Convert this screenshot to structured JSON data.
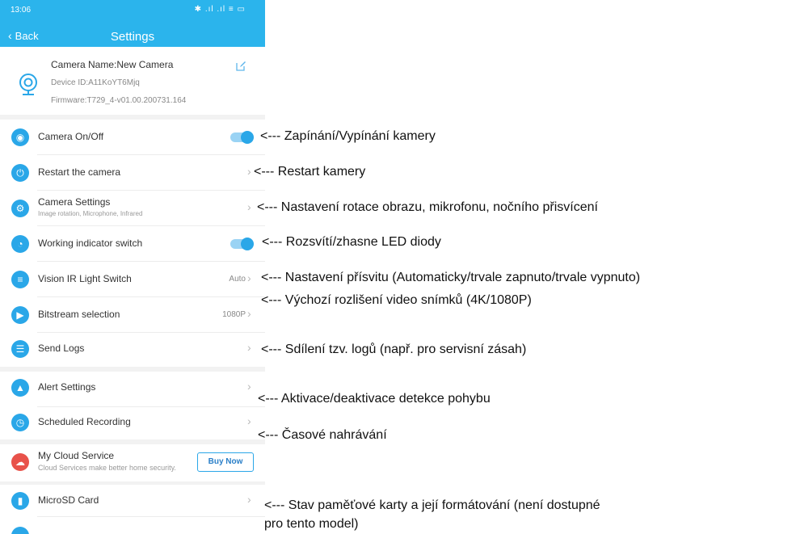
{
  "status_bar": {
    "time": "13:06",
    "icons": "✱ .ıl .ıl ≡ ▭"
  },
  "header": {
    "back_label": "Back",
    "title": "Settings"
  },
  "device": {
    "name": "Camera Name:New Camera",
    "id": "Device ID:A11KoYT6Mjq",
    "firmware": "Firmware:T729_4-v01.00.200731.164"
  },
  "rows": [
    {
      "label": "Camera On/Off",
      "control": "toggle",
      "on": true,
      "icon": "camera-icon"
    },
    {
      "label": "Restart the camera",
      "control": "chevron",
      "icon": "power-icon"
    },
    {
      "label": "Camera Settings",
      "sub": "Image rotation, Microphone, Infrared",
      "control": "chevron",
      "icon": "camera-settings-icon"
    },
    {
      "label": "Working indicator switch",
      "control": "toggle",
      "on": true,
      "icon": "bell-indicator-icon"
    },
    {
      "label": "Vision IR Light Switch",
      "value": "Auto",
      "control": "chevron",
      "icon": "ir-light-icon"
    },
    {
      "label": "Bitstream selection",
      "value": "1080P",
      "control": "chevron",
      "icon": "play-icon"
    },
    {
      "label": "Send Logs",
      "control": "chevron",
      "icon": "document-icon"
    },
    {
      "label": "Alert Settings",
      "control": "chevron",
      "icon": "alert-bell-icon"
    },
    {
      "label": "Scheduled Recording",
      "control": "chevron",
      "icon": "clock-icon"
    },
    {
      "label": "My Cloud Service",
      "sub": "Cloud Services make better home security.",
      "button": "Buy Now",
      "icon": "cloud-icon"
    },
    {
      "label": "MicroSD Card",
      "control": "chevron",
      "icon": "sd-card-icon"
    }
  ],
  "annotations": [
    "<--- Zapínání/Vypínání kamery",
    "<--- Restart kamery",
    "<--- Nastavení rotace obrazu, mikrofonu, nočního přisvícení",
    "<--- Rozsvítí/zhasne LED diody",
    "<--- Nastavení přísvitu (Automaticky/trvale zapnuto/trvale vypnuto)",
    "<--- Výchozí rozlišení video snímků (4K/1080P)",
    "<--- Sdílení tzv. logů (např. pro servisní zásah)",
    "<--- Aktivace/deaktivace detekce pohybu",
    "<--- Časové nahrávání",
    "<--- Stav paměťové karty a její formátování (není dostupné",
    "pro tento model)"
  ],
  "colors": {
    "accent": "#2bb4ec",
    "icon": "#2aa7e8",
    "cloud": "#e8524a"
  }
}
